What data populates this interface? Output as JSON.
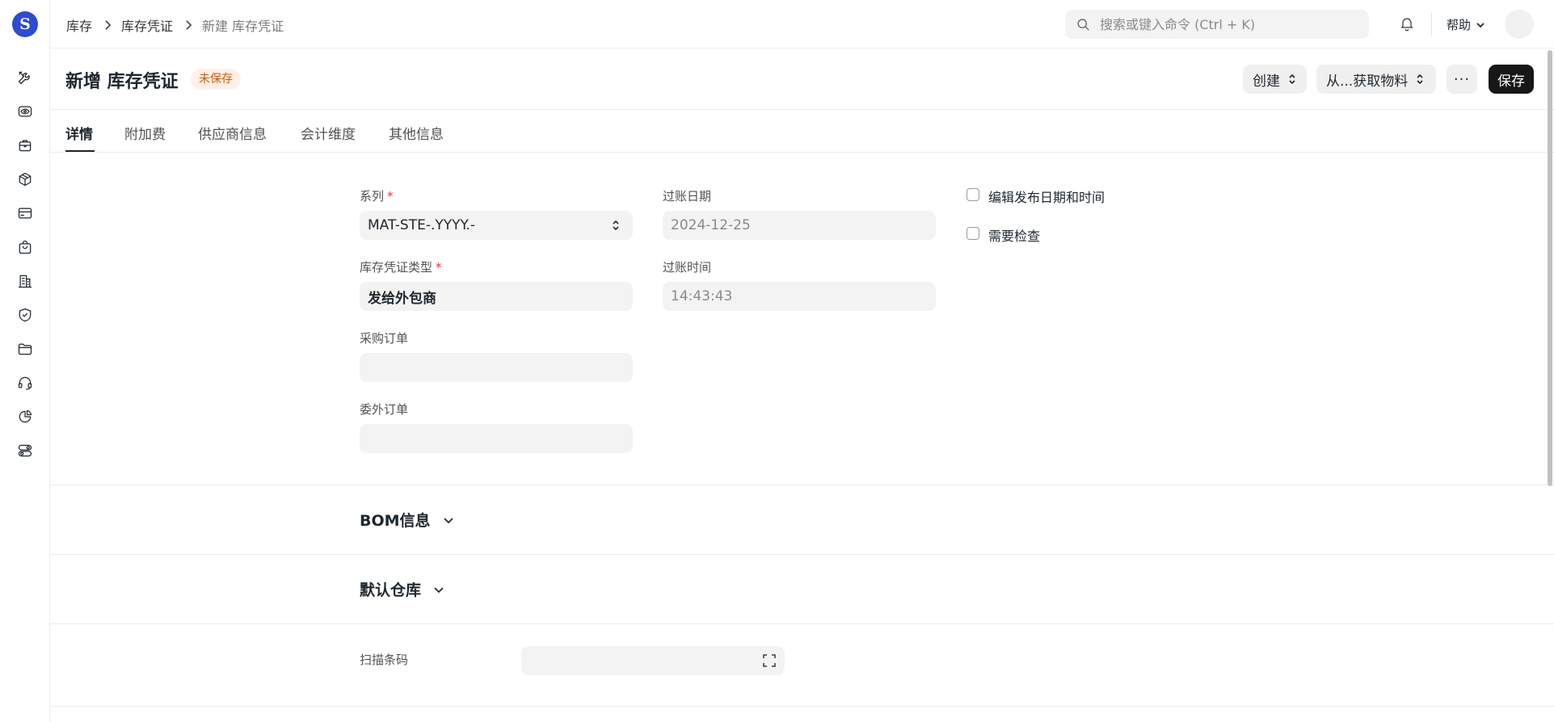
{
  "app": {
    "logo_letter": "S"
  },
  "breadcrumb": [
    "库存",
    "库存凭证",
    "新建 库存凭证"
  ],
  "search": {
    "placeholder": "搜索或键入命令 (Ctrl + K)"
  },
  "topbar": {
    "help_label": "帮助"
  },
  "sidebar": {
    "icons": [
      "tools-icon",
      "eye-icon",
      "briefcase-icon",
      "box-icon",
      "card-icon",
      "bag-icon",
      "building-icon",
      "shield-icon",
      "folder-icon",
      "headset-icon",
      "pie-chart-icon",
      "toggles-icon"
    ]
  },
  "page": {
    "title": "新增 库存凭证",
    "status_badge": "未保存",
    "buttons": {
      "create": "创建",
      "fetch": "从...获取物料",
      "more": "···",
      "save": "保存"
    }
  },
  "tabs": [
    "详情",
    "附加费",
    "供应商信息",
    "会计维度",
    "其他信息"
  ],
  "form": {
    "series": {
      "label": "系列",
      "required": "*",
      "value": "MAT-STE-.YYYY.-"
    },
    "entry_type": {
      "label": "库存凭证类型",
      "required": "*",
      "value": "发给外包商"
    },
    "purchase_order": {
      "label": "采购订单",
      "value": ""
    },
    "subcontract_order": {
      "label": "委外订单",
      "value": ""
    },
    "posting_date": {
      "label": "过账日期",
      "value": "2024-12-25"
    },
    "posting_time": {
      "label": "过账时间",
      "value": "14:43:43"
    },
    "edit_posting": {
      "label": "编辑发布日期和时间",
      "checked": false
    },
    "inspection": {
      "label": "需要检查",
      "checked": false
    }
  },
  "sections": {
    "bom": "BOM信息",
    "warehouse": "默认仓库"
  },
  "scan": {
    "label": "扫描条码",
    "value": ""
  },
  "colors": {
    "accent": "#171717",
    "badge_bg": "#fff1e7",
    "badge_text": "#d0560b",
    "logo": "#2e4bd1",
    "required": "#e03636"
  }
}
